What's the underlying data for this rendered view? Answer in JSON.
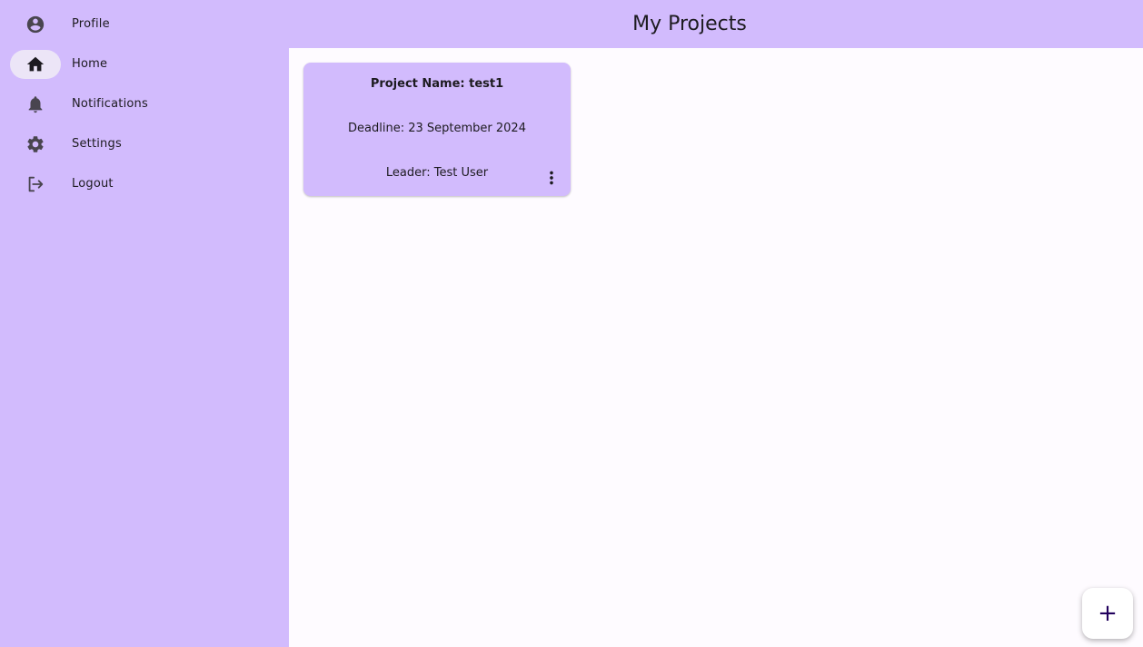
{
  "sidebar": {
    "items": [
      {
        "label": "Profile",
        "icon": "account-circle-icon",
        "active": false
      },
      {
        "label": "Home",
        "icon": "home-icon",
        "active": true
      },
      {
        "label": "Notifications",
        "icon": "bell-icon",
        "active": false
      },
      {
        "label": "Settings",
        "icon": "gear-icon",
        "active": false
      },
      {
        "label": "Logout",
        "icon": "logout-icon",
        "active": false
      }
    ]
  },
  "header": {
    "title": "My Projects"
  },
  "projects": [
    {
      "name": "Project Name: test1",
      "deadline": "Deadline: 23 September 2024",
      "leader": "Leader: Test User",
      "menu_icon": "more-vert-icon"
    }
  ],
  "fab": {
    "label": "+",
    "icon": "add-icon"
  },
  "colors": {
    "accent": "#d2bbfd",
    "background": "#fefbff",
    "active_indicator": "#ece5f7",
    "icon": "#49454f",
    "fab_glyph": "#21005d"
  }
}
